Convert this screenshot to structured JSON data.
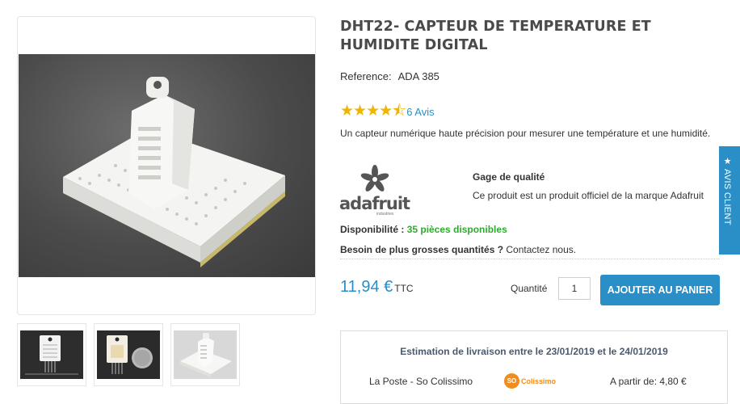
{
  "product": {
    "title": "DHT22- CAPTEUR DE TEMPERATURE ET HUMIDITE DIGITAL",
    "reference_label": "Reference:",
    "reference_value": "ADA 385",
    "rating": 4.5,
    "rating_max": 5,
    "reviews_link": "6 Avis",
    "description": "Un capteur numérique haute précision pour mesurer une température et une humidité."
  },
  "brand": {
    "logo_word": "adafruit",
    "logo_sub": "industries",
    "quality_title": "Gage de qualité",
    "quality_text": "Ce produit est un produit officiel de la marque Adafruit"
  },
  "stock": {
    "label": "Disponibilité :",
    "value": "35 pièces disponibles"
  },
  "bulk": {
    "question": "Besoin de plus grosses quantités ?",
    "contact": "Contactez nous."
  },
  "purchase": {
    "price": "11,94 €",
    "tax_label": "TTC",
    "quantity_label": "Quantité",
    "quantity_value": "1",
    "add_to_cart": "AJOUTER AU PANIER"
  },
  "delivery": {
    "estimate": "Estimation de livraison entre le 23/01/2019 et le 24/01/2019",
    "carrier": "La Poste - So Colissimo",
    "carrier_logo_mark": "SO",
    "carrier_logo_text": "Colissimo",
    "price_from": "A partir de: 4,80 €"
  },
  "side_tab": {
    "icon": "star-icon",
    "label": "★ AVIS CLIENT"
  },
  "colors": {
    "accent": "#2a8fc7",
    "stock_green": "#2eab2e",
    "star": "#f0b400",
    "colissimo": "#f28c1c"
  }
}
